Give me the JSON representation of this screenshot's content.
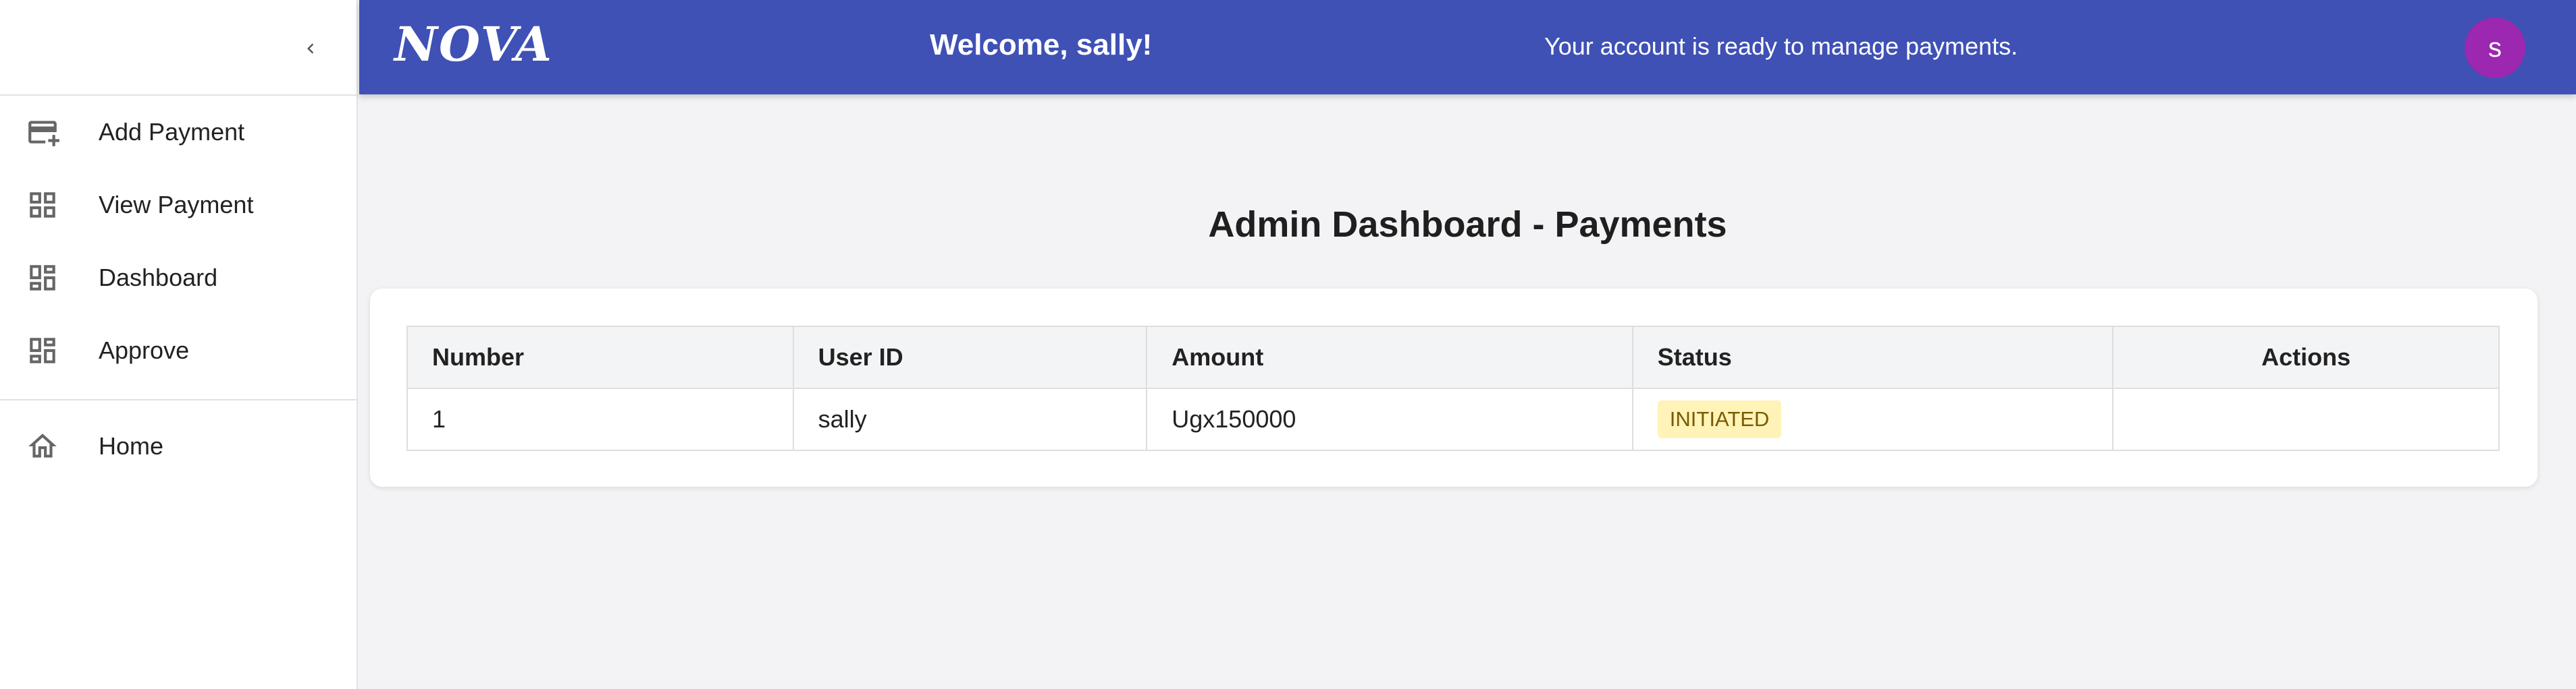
{
  "header": {
    "brand": "NOVA",
    "welcome": "Welcome, sally!",
    "message": "Your account is ready to manage payments.",
    "avatar_letter": "s",
    "bg_color": "#3f51b5",
    "avatar_color": "#9c27b0"
  },
  "sidebar": {
    "items": [
      {
        "label": "Add Payment",
        "icon": "add-card-icon"
      },
      {
        "label": "View Payment",
        "icon": "grid-icon"
      },
      {
        "label": "Dashboard",
        "icon": "dashboard-icon"
      },
      {
        "label": "Approve",
        "icon": "dashboard-icon"
      }
    ],
    "home": {
      "label": "Home",
      "icon": "home-icon"
    }
  },
  "main": {
    "title": "Admin Dashboard - Payments",
    "table": {
      "columns": [
        "Number",
        "User ID",
        "Amount",
        "Status",
        "Actions"
      ],
      "rows": [
        {
          "number": "1",
          "user_id": "sally",
          "amount": "Ugx150000",
          "status": "INITIATED",
          "actions": ""
        }
      ]
    }
  }
}
